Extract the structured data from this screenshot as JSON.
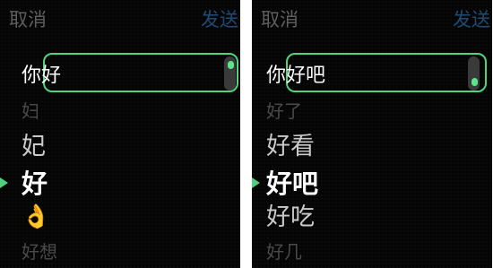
{
  "screens": [
    {
      "cancel_label": "取消",
      "send_label": "发送",
      "compose_text": "你好",
      "candidates": [
        "妇",
        "妃",
        "好",
        "👌",
        "好想"
      ],
      "selected_index": 2
    },
    {
      "cancel_label": "取消",
      "send_label": "发送",
      "compose_text": "你好吧",
      "candidates": [
        "好了",
        "好看",
        "好吧",
        "好吃",
        "好几"
      ],
      "selected_index": 2
    }
  ],
  "colors": {
    "background": "#050505",
    "accent_green": "#54d37f",
    "send_blue": "#1f4a73",
    "cancel_gray": "#5f5f5f"
  },
  "icons": {
    "selection": "triangle-right",
    "ok_hand": "👌"
  }
}
